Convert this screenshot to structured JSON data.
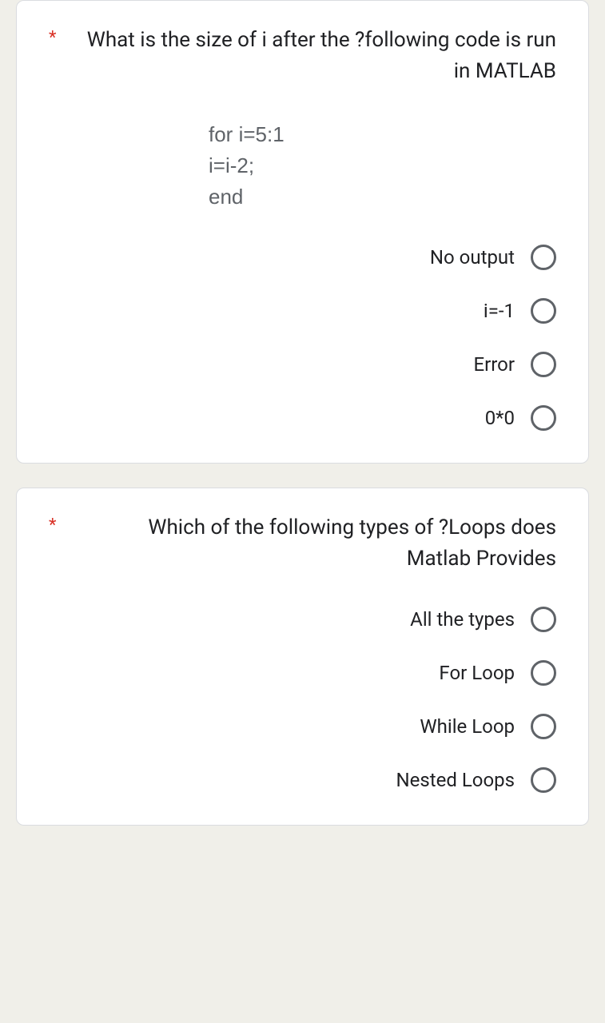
{
  "questions": [
    {
      "required": "*",
      "text": "What is the size of i after the ?following code is run in MATLAB",
      "code": [
        "for i=5:1",
        "i=i-2;",
        "end"
      ],
      "options": [
        "No output",
        "i=-1",
        "Error",
        "0*0"
      ]
    },
    {
      "required": "*",
      "text": "Which of the following types of ?Loops does Matlab Provides",
      "options": [
        "All the types",
        "For Loop",
        "While Loop",
        "Nested Loops"
      ]
    }
  ]
}
